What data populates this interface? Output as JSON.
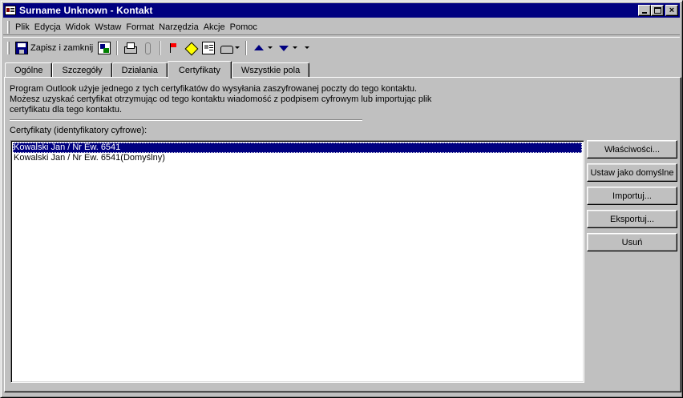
{
  "window": {
    "title": "Surname Unknown - Kontakt",
    "icon": "contact-card-icon",
    "controls": [
      "minimize",
      "maximize",
      "close"
    ]
  },
  "menu": {
    "items": [
      "Plik",
      "Edycja",
      "Widok",
      "Wstaw",
      "Format",
      "Narzędzia",
      "Akcje",
      "Pomoc"
    ]
  },
  "toolbar": {
    "save_close_label": "Zapisz i zamknij",
    "icons": [
      "save-close-icon",
      "save-as-icon",
      "print-icon",
      "attach-icon",
      "flag-icon",
      "new-meeting-icon",
      "business-card-icon",
      "dial-icon",
      "previous-item-icon",
      "next-item-icon"
    ]
  },
  "tabs": [
    {
      "label": "Ogólne",
      "active": false
    },
    {
      "label": "Szczegóły",
      "active": false
    },
    {
      "label": "Działania",
      "active": false
    },
    {
      "label": "Certyfikaty",
      "active": true
    },
    {
      "label": "Wszystkie pola",
      "active": false
    }
  ],
  "certificates": {
    "info_lines": [
      "Program Outlook użyje jednego z tych certyfikatów do wysyłania zaszyfrowanej poczty do tego kontaktu.",
      "Możesz uzyskać certyfikat otrzymując od tego kontaktu wiadomość z podpisem cyfrowym lub importując plik",
      "certyfikatu dla tego kontaktu."
    ],
    "list_label": "Certyfikaty (identyfikatory cyfrowe):",
    "items": [
      {
        "text": "Kowalski Jan / Nr Ew. 6541",
        "selected": true
      },
      {
        "text": "Kowalski Jan / Nr Ew. 6541(Domyślny)",
        "selected": false
      }
    ],
    "buttons": {
      "properties": "Właściwości...",
      "set_default": "Ustaw jako domyślne",
      "import": "Importuj...",
      "export": "Eksportuj...",
      "remove": "Usuń"
    }
  },
  "colors": {
    "titlebar": "#000080",
    "face": "#c0c0c0",
    "selection": "#000080"
  }
}
